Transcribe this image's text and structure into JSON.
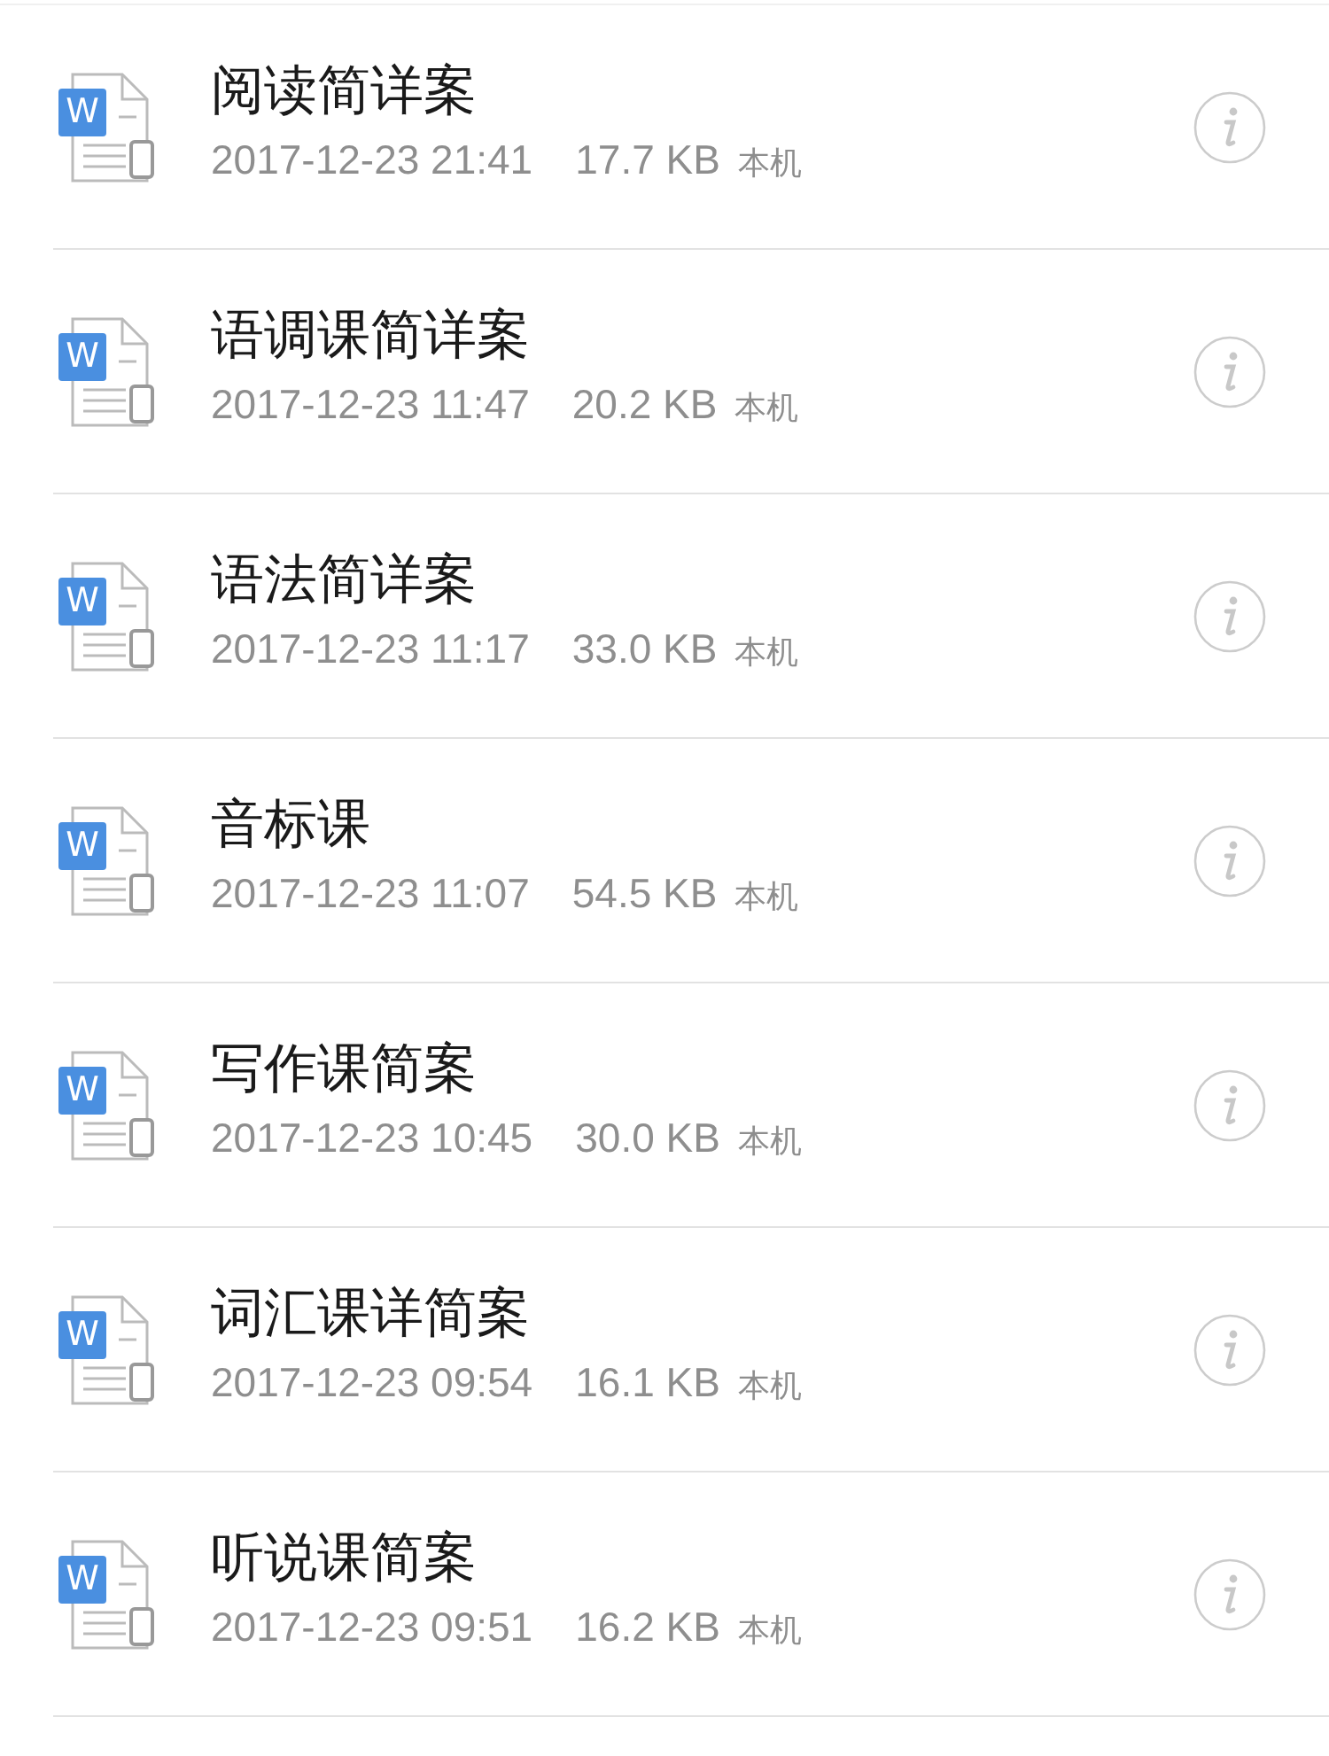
{
  "files": [
    {
      "name": "阅读简详案",
      "date": "2017-12-23 21:41",
      "size": "17.7 KB",
      "location": "本机",
      "badge": "W"
    },
    {
      "name": "语调课简详案",
      "date": "2017-12-23 11:47",
      "size": "20.2 KB",
      "location": "本机",
      "badge": "W"
    },
    {
      "name": "语法简详案",
      "date": "2017-12-23 11:17",
      "size": "33.0 KB",
      "location": "本机",
      "badge": "W"
    },
    {
      "name": "音标课",
      "date": "2017-12-23 11:07",
      "size": "54.5 KB",
      "location": "本机",
      "badge": "W"
    },
    {
      "name": "写作课简案",
      "date": "2017-12-23 10:45",
      "size": "30.0 KB",
      "location": "本机",
      "badge": "W"
    },
    {
      "name": "词汇课详简案",
      "date": "2017-12-23 09:54",
      "size": "16.1 KB",
      "location": "本机",
      "badge": "W"
    },
    {
      "name": "听说课简案",
      "date": "2017-12-23 09:51",
      "size": "16.2 KB",
      "location": "本机",
      "badge": "W"
    }
  ]
}
